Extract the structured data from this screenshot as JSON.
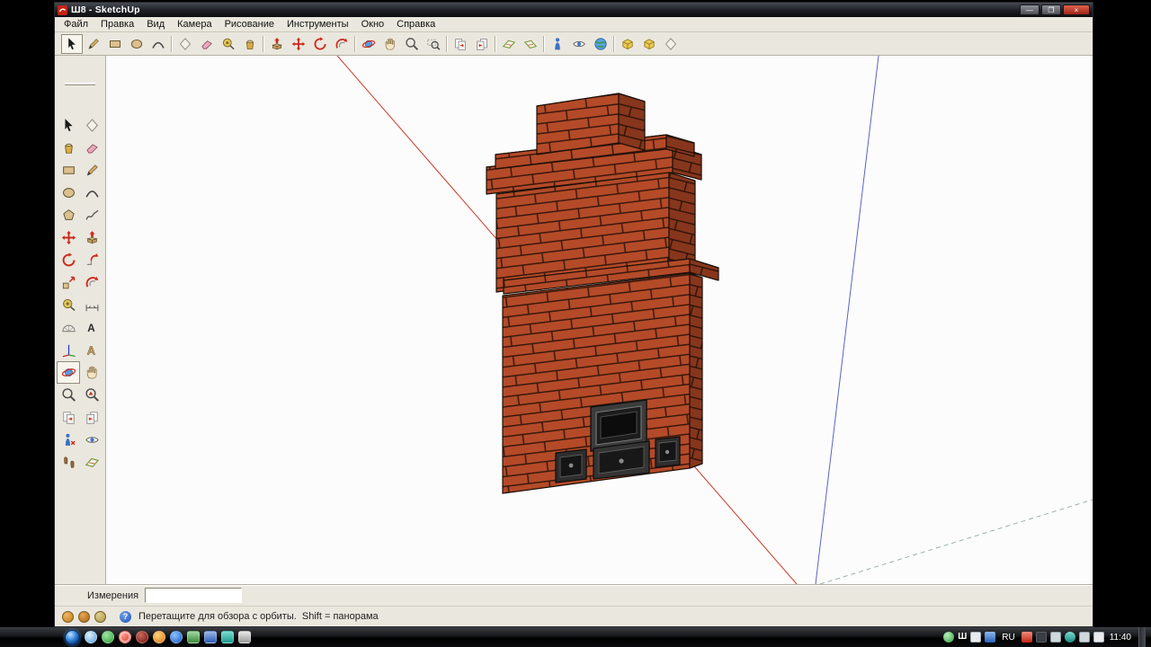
{
  "window": {
    "title": "Ш8 - SketchUp",
    "controls": {
      "minimize": "—",
      "maximize": "❐",
      "close": "×"
    }
  },
  "menu": {
    "items": [
      "Файл",
      "Правка",
      "Вид",
      "Камера",
      "Рисование",
      "Инструменты",
      "Окно",
      "Справка"
    ]
  },
  "toolbar": {
    "tools": [
      "select",
      "line",
      "rectangle",
      "circle",
      "arc",
      "make-component",
      "eraser",
      "tape-measure",
      "paint-bucket",
      "push-pull",
      "move",
      "rotate",
      "offset",
      "orbit",
      "pan",
      "zoom",
      "zoom-window",
      "previous-view",
      "next-view",
      "section-plane",
      "section-cuts",
      "position-camera",
      "look-around",
      "google-earth",
      "get-models",
      "share-models",
      "component-options"
    ]
  },
  "palette": {
    "tools": [
      [
        "select",
        "make-component"
      ],
      [
        "paint-bucket",
        "eraser"
      ],
      [
        "rectangle",
        "line"
      ],
      [
        "circle",
        "arc"
      ],
      [
        "polygon",
        "freehand"
      ],
      [
        "move",
        "push-pull"
      ],
      [
        "rotate",
        "follow-me"
      ],
      [
        "scale",
        "offset"
      ],
      [
        "tape-measure",
        "dimension"
      ],
      [
        "protractor",
        "text"
      ],
      [
        "axes",
        "3d-text"
      ],
      [
        "orbit",
        "pan"
      ],
      [
        "zoom",
        "zoom-extents"
      ],
      [
        "previous-view",
        "next-view"
      ],
      [
        "position-camera",
        "look-around"
      ],
      [
        "walk",
        "section-plane"
      ]
    ]
  },
  "viewport": {
    "model": "кирпичная печь",
    "axis_colors": {
      "red": "#cc3a2a",
      "blue": "#5a62c8"
    }
  },
  "measurements": {
    "label": "Измерения",
    "value": ""
  },
  "statusbar": {
    "hint": "Перетащите для обзора с орбиты.  Shift = панорама",
    "help_glyph": "?"
  },
  "taskbar": {
    "app_badge": "Ш",
    "language": "RU",
    "time": "11:40"
  }
}
